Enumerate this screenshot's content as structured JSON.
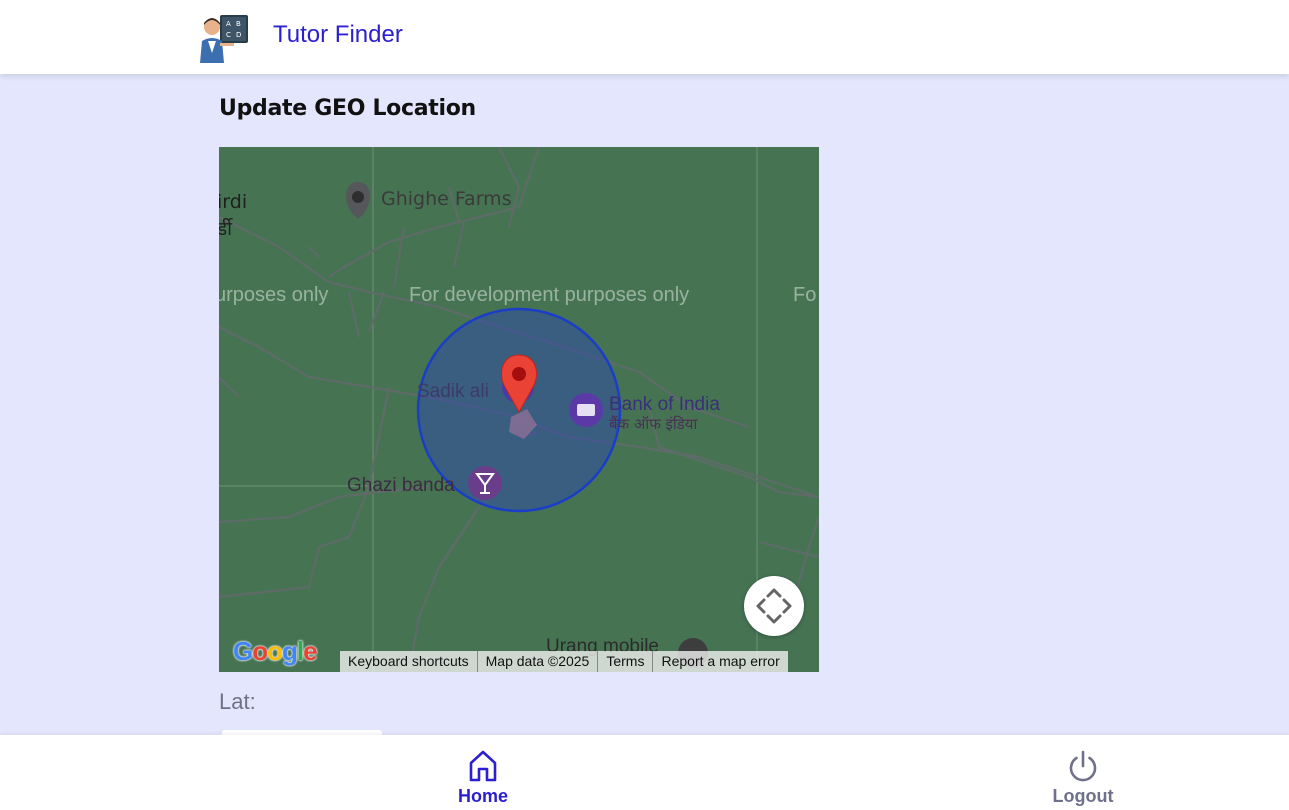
{
  "header": {
    "app_title": "Tutor Finder",
    "logo_icon": "teacher-avatar-icon",
    "brand_color": "#2b1fd1"
  },
  "main": {
    "page_title": "Update GEO Location",
    "lat_label": "Lat:"
  },
  "map": {
    "background_color": "#467453",
    "place_labels": {
      "ghighe_farms": "Ghighe Farms",
      "shirdi_en": "irdi",
      "shirdi_hi": "र्डी",
      "sadik_ali": "Sadik ali",
      "bank_of_india": "Bank of India",
      "bank_of_india_hi": "बैंक ऑफ इंडिया",
      "ghazi_banda": "Ghazi banda",
      "urang_mobile": "Urang mobile"
    },
    "watermarks": {
      "left": "urposes only",
      "center": "For development purposes only",
      "right": "Fo"
    },
    "google_logo": "Google",
    "footer": {
      "keyboard_shortcuts": "Keyboard shortcuts",
      "map_data": "Map data ©2025",
      "terms": "Terms",
      "report": "Report a map error"
    },
    "marker_color": "#ea4335",
    "radius_circle_color": "#1a3ec8"
  },
  "bottom_nav": {
    "home_label": "Home",
    "logout_label": "Logout",
    "active_color": "#2b1fd1",
    "inactive_color": "#6f7089"
  }
}
